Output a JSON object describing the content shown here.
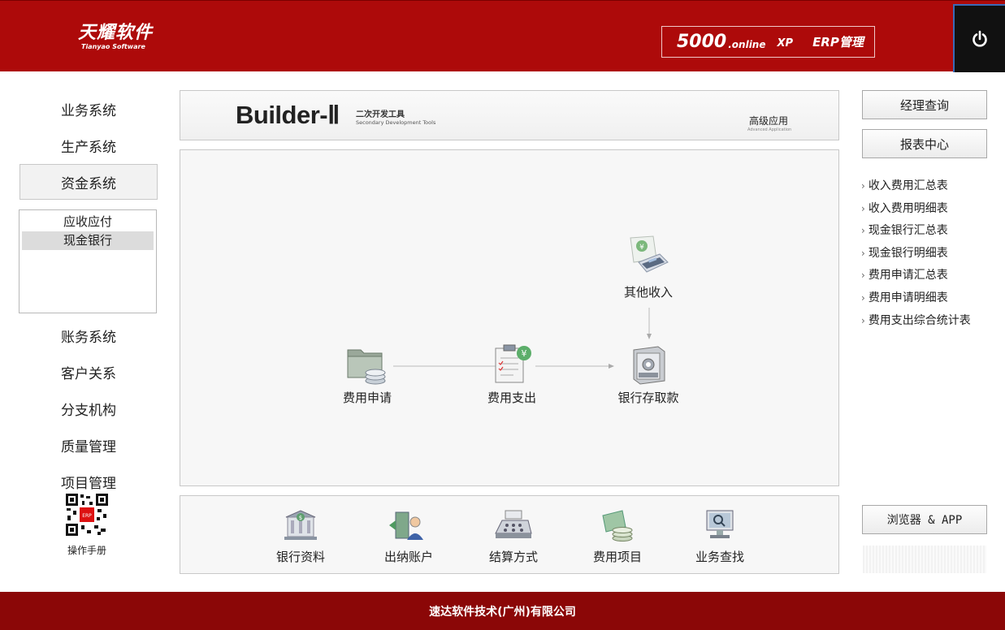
{
  "header": {
    "logo_cn": "天耀软件",
    "logo_en": "Tianyao Software",
    "product_num": "5000",
    "product_online": ".online",
    "product_xp": "XP",
    "product_erp": "ERP管理"
  },
  "nav": {
    "items_top": [
      "业务系统",
      "生产系统",
      "资金系统"
    ],
    "sub_items": [
      "应收应付",
      "现金银行"
    ],
    "items_bottom": [
      "账务系统",
      "客户关系",
      "分支机构",
      "质量管理",
      "项目管理"
    ],
    "manual_label": "操作手册"
  },
  "banner": {
    "title": "Builder-Ⅱ",
    "sub_cn": "二次开发工具",
    "sub_en": "Secondary Development Tools",
    "adv_cn": "高级应用",
    "adv_en": "Advanced Application"
  },
  "flow": {
    "other_income": "其他收入",
    "expense_apply": "费用申请",
    "expense_pay": "费用支出",
    "bank_deposit": "银行存取款"
  },
  "tools": [
    "银行资料",
    "出纳账户",
    "结算方式",
    "费用项目",
    "业务查找"
  ],
  "right": {
    "manager_query": "经理查询",
    "report_center": "报表中心",
    "reports": [
      "收入费用汇总表",
      "收入费用明细表",
      "现金银行汇总表",
      "现金银行明细表",
      "费用申请汇总表",
      "费用申请明细表",
      "费用支出综合统计表"
    ],
    "browser_app": "浏览器 & APP"
  },
  "footer": {
    "company": "速达软件技术(广州)有限公司"
  },
  "colors": {
    "header_red": "#ad0a0a",
    "footer_red": "#8b0707"
  }
}
